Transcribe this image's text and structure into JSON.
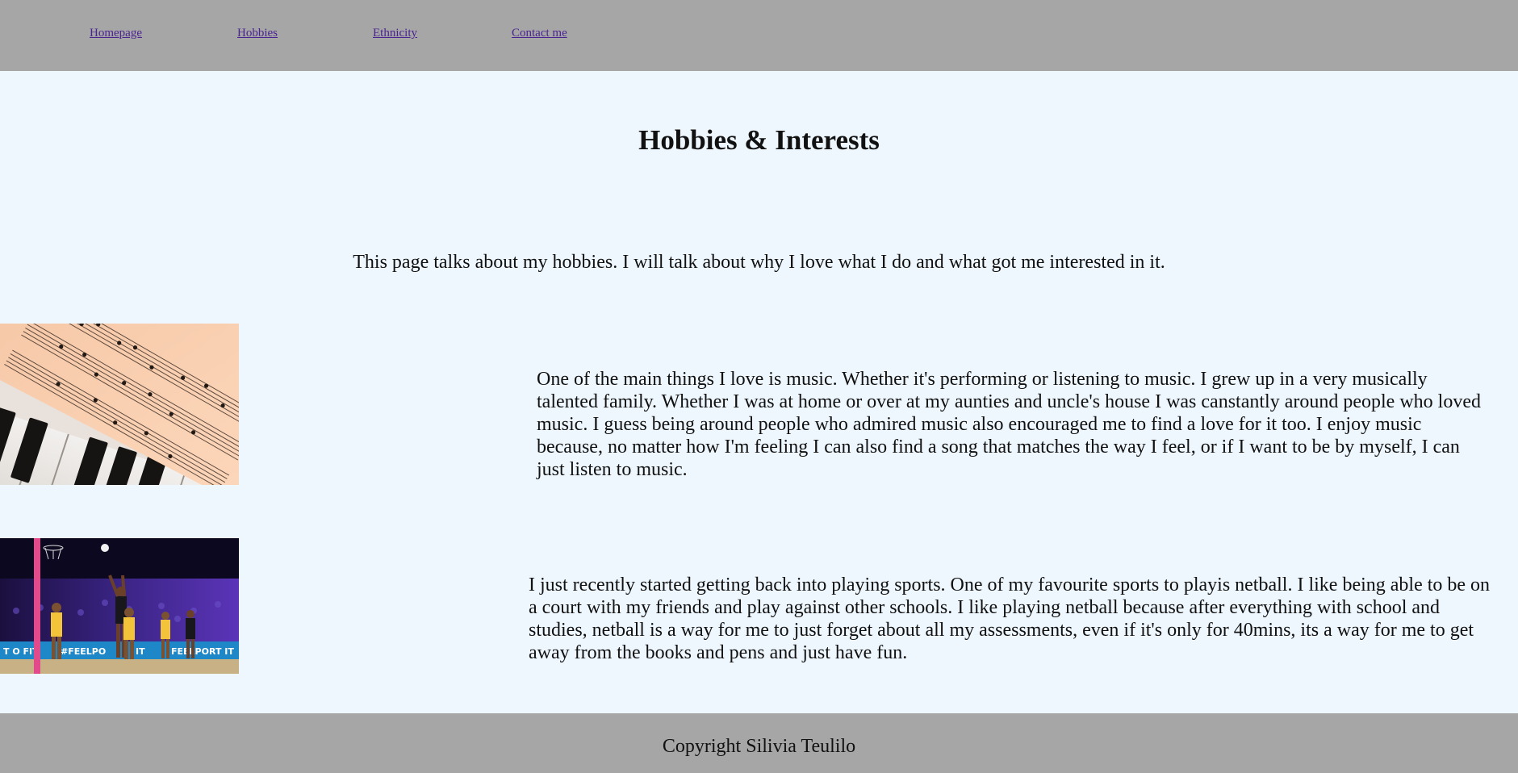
{
  "nav": {
    "links": [
      {
        "label": "Homepage"
      },
      {
        "label": "Hobbies"
      },
      {
        "label": "Ethnicity"
      },
      {
        "label": "Contact me"
      }
    ]
  },
  "main": {
    "title": "Hobbies & Interests",
    "intro": "This page talks about my hobbies. I will talk about why I love what I do and what got me interested in it.",
    "sections": [
      {
        "image": "sheet-music-piano-photo",
        "text": "One of the main things I love is music. Whether it's performing or listening to music. I grew up in a very musically talented family. Whether I was at home or over at my aunties and uncle's house I was canstantly around people who loved music. I guess being around people who admired music also encouraged me to find a love for it too. I enjoy music because, no matter how I'm feeling I can also find a song that matches the way I feel, or if I want to be by myself, I can just listen to music."
      },
      {
        "image": "netball-game-photo",
        "text": "I just recently started getting back into playing sports. One of my favourite sports to playis netball. I like being able to be on a court with my friends and play against other schools. I like playing netball because after everything with school and studies, netball is a way for me to just forget about all my assessments, even if it's only for 40mins, its a way for me to get away from the books and pens and just have fun.",
        "banner_fragments": [
          "T O FIT",
          "#FEELPO",
          "IT",
          "FEELPORT IT"
        ]
      }
    ]
  },
  "footer": {
    "text": "Copyright Silivia Teulilo"
  },
  "colors": {
    "nav_bg": "#a6a6a6",
    "page_bg": "#eef7fe",
    "link": "#4b2390"
  }
}
